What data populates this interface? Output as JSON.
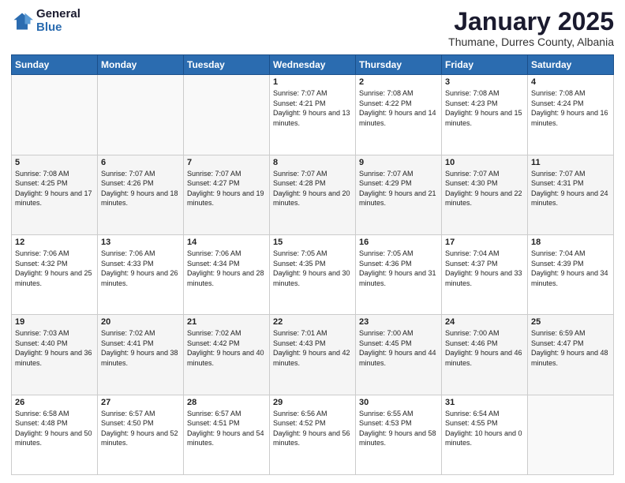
{
  "logo": {
    "general": "General",
    "blue": "Blue"
  },
  "header": {
    "month": "January 2025",
    "location": "Thumane, Durres County, Albania"
  },
  "days_of_week": [
    "Sunday",
    "Monday",
    "Tuesday",
    "Wednesday",
    "Thursday",
    "Friday",
    "Saturday"
  ],
  "weeks": [
    [
      {
        "day": "",
        "info": ""
      },
      {
        "day": "",
        "info": ""
      },
      {
        "day": "",
        "info": ""
      },
      {
        "day": "1",
        "info": "Sunrise: 7:07 AM\nSunset: 4:21 PM\nDaylight: 9 hours and 13 minutes."
      },
      {
        "day": "2",
        "info": "Sunrise: 7:08 AM\nSunset: 4:22 PM\nDaylight: 9 hours and 14 minutes."
      },
      {
        "day": "3",
        "info": "Sunrise: 7:08 AM\nSunset: 4:23 PM\nDaylight: 9 hours and 15 minutes."
      },
      {
        "day": "4",
        "info": "Sunrise: 7:08 AM\nSunset: 4:24 PM\nDaylight: 9 hours and 16 minutes."
      }
    ],
    [
      {
        "day": "5",
        "info": "Sunrise: 7:08 AM\nSunset: 4:25 PM\nDaylight: 9 hours and 17 minutes."
      },
      {
        "day": "6",
        "info": "Sunrise: 7:07 AM\nSunset: 4:26 PM\nDaylight: 9 hours and 18 minutes."
      },
      {
        "day": "7",
        "info": "Sunrise: 7:07 AM\nSunset: 4:27 PM\nDaylight: 9 hours and 19 minutes."
      },
      {
        "day": "8",
        "info": "Sunrise: 7:07 AM\nSunset: 4:28 PM\nDaylight: 9 hours and 20 minutes."
      },
      {
        "day": "9",
        "info": "Sunrise: 7:07 AM\nSunset: 4:29 PM\nDaylight: 9 hours and 21 minutes."
      },
      {
        "day": "10",
        "info": "Sunrise: 7:07 AM\nSunset: 4:30 PM\nDaylight: 9 hours and 22 minutes."
      },
      {
        "day": "11",
        "info": "Sunrise: 7:07 AM\nSunset: 4:31 PM\nDaylight: 9 hours and 24 minutes."
      }
    ],
    [
      {
        "day": "12",
        "info": "Sunrise: 7:06 AM\nSunset: 4:32 PM\nDaylight: 9 hours and 25 minutes."
      },
      {
        "day": "13",
        "info": "Sunrise: 7:06 AM\nSunset: 4:33 PM\nDaylight: 9 hours and 26 minutes."
      },
      {
        "day": "14",
        "info": "Sunrise: 7:06 AM\nSunset: 4:34 PM\nDaylight: 9 hours and 28 minutes."
      },
      {
        "day": "15",
        "info": "Sunrise: 7:05 AM\nSunset: 4:35 PM\nDaylight: 9 hours and 30 minutes."
      },
      {
        "day": "16",
        "info": "Sunrise: 7:05 AM\nSunset: 4:36 PM\nDaylight: 9 hours and 31 minutes."
      },
      {
        "day": "17",
        "info": "Sunrise: 7:04 AM\nSunset: 4:37 PM\nDaylight: 9 hours and 33 minutes."
      },
      {
        "day": "18",
        "info": "Sunrise: 7:04 AM\nSunset: 4:39 PM\nDaylight: 9 hours and 34 minutes."
      }
    ],
    [
      {
        "day": "19",
        "info": "Sunrise: 7:03 AM\nSunset: 4:40 PM\nDaylight: 9 hours and 36 minutes."
      },
      {
        "day": "20",
        "info": "Sunrise: 7:02 AM\nSunset: 4:41 PM\nDaylight: 9 hours and 38 minutes."
      },
      {
        "day": "21",
        "info": "Sunrise: 7:02 AM\nSunset: 4:42 PM\nDaylight: 9 hours and 40 minutes."
      },
      {
        "day": "22",
        "info": "Sunrise: 7:01 AM\nSunset: 4:43 PM\nDaylight: 9 hours and 42 minutes."
      },
      {
        "day": "23",
        "info": "Sunrise: 7:00 AM\nSunset: 4:45 PM\nDaylight: 9 hours and 44 minutes."
      },
      {
        "day": "24",
        "info": "Sunrise: 7:00 AM\nSunset: 4:46 PM\nDaylight: 9 hours and 46 minutes."
      },
      {
        "day": "25",
        "info": "Sunrise: 6:59 AM\nSunset: 4:47 PM\nDaylight: 9 hours and 48 minutes."
      }
    ],
    [
      {
        "day": "26",
        "info": "Sunrise: 6:58 AM\nSunset: 4:48 PM\nDaylight: 9 hours and 50 minutes."
      },
      {
        "day": "27",
        "info": "Sunrise: 6:57 AM\nSunset: 4:50 PM\nDaylight: 9 hours and 52 minutes."
      },
      {
        "day": "28",
        "info": "Sunrise: 6:57 AM\nSunset: 4:51 PM\nDaylight: 9 hours and 54 minutes."
      },
      {
        "day": "29",
        "info": "Sunrise: 6:56 AM\nSunset: 4:52 PM\nDaylight: 9 hours and 56 minutes."
      },
      {
        "day": "30",
        "info": "Sunrise: 6:55 AM\nSunset: 4:53 PM\nDaylight: 9 hours and 58 minutes."
      },
      {
        "day": "31",
        "info": "Sunrise: 6:54 AM\nSunset: 4:55 PM\nDaylight: 10 hours and 0 minutes."
      },
      {
        "day": "",
        "info": ""
      }
    ]
  ]
}
